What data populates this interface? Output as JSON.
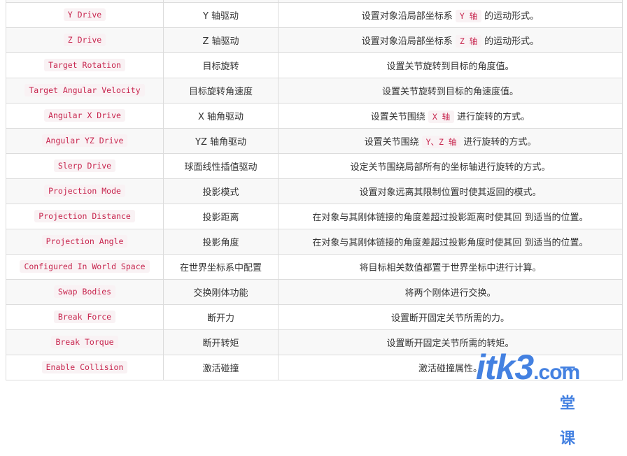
{
  "rows": [
    {
      "property": "",
      "name": "",
      "desc": [
        ""
      ]
    },
    {
      "property": "Y Drive",
      "name": "Y 轴驱动",
      "desc": [
        "设置对象沿局部坐标系",
        "Y 轴",
        "的运动形式。"
      ]
    },
    {
      "property": "Z Drive",
      "name": "Z 轴驱动",
      "desc": [
        "设置对象沿局部坐标系",
        "Z 轴",
        "的运动形式。"
      ]
    },
    {
      "property": "Target Rotation",
      "name": "目标旋转",
      "desc": [
        "设置关节旋转到目标的角度值。"
      ]
    },
    {
      "property": "Target Angular Velocity",
      "name": "目标旋转角速度",
      "desc": [
        "设置关节旋转到目标的角速度值。"
      ]
    },
    {
      "property": "Angular X Drive",
      "name": "X 轴角驱动",
      "desc": [
        "设置关节围绕",
        "X 轴",
        "进行旋转的方式。"
      ]
    },
    {
      "property": "Angular YZ Drive",
      "name": "YZ 轴角驱动",
      "desc": [
        "设置关节围绕",
        "Y、Z 轴",
        "进行旋转的方式。"
      ]
    },
    {
      "property": "Slerp Drive",
      "name": "球面线性插值驱动",
      "desc": [
        "设定关节围绕局部所有的坐标轴进行旋转的方式。"
      ]
    },
    {
      "property": "Projection Mode",
      "name": "投影模式",
      "desc": [
        "设置对象远离其限制位置时使其返回的模式。"
      ]
    },
    {
      "property": "Projection Distance",
      "name": "投影距离",
      "desc": [
        "在对象与其刚体链接的角度差超过投影距离时使其回 到适当的位置。"
      ]
    },
    {
      "property": "Projection Angle",
      "name": "投影角度",
      "desc": [
        "在对象与其刚体链接的角度差超过投影角度时使其回 到适当的位置。"
      ]
    },
    {
      "property": "Configured In World Space",
      "name": "在世界坐标系中配置",
      "desc": [
        "将目标相关数值都置于世界坐标中进行计算。"
      ]
    },
    {
      "property": "Swap Bodies",
      "name": "交换刚体功能",
      "desc": [
        "将两个刚体进行交换。"
      ]
    },
    {
      "property": "Break Force",
      "name": "断开力",
      "desc": [
        "设置断开固定关节所需的力。"
      ]
    },
    {
      "property": "Break Torque",
      "name": "断开转矩",
      "desc": [
        "设置断开固定关节所需的转矩。"
      ]
    },
    {
      "property": "Enable Collision",
      "name": "激活碰撞",
      "desc": [
        "激活碰撞属性。"
      ]
    }
  ],
  "watermark": {
    "text": "itk3",
    "suffix": ".com",
    "cn": "一堂课"
  },
  "colors": {
    "code_text": "#c7254e",
    "code_bg": "#f9f2f4",
    "watermark": "#3a7be0"
  }
}
